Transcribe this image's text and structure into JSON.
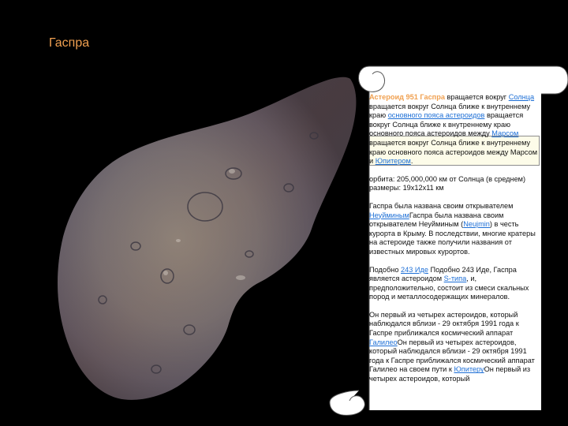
{
  "slide": {
    "title": "Гаспра"
  },
  "icons": {
    "scroll-top-curl": "scroll-curl-icon",
    "scroll-bottom-curl": "scroll-curl-icon"
  },
  "colors": {
    "title": "#f0a050",
    "link": "#1d6fd6",
    "background": "#000000",
    "scroll": "#ffffff"
  },
  "text": {
    "p1_lead": "Астероид 951 Гаспра",
    "p1_a": " вращается вокруг ",
    "p1_link_sun": "Солнца",
    "p1_b": " вращается вокруг Солнца ближе к внутреннему краю ",
    "p1_link_belt": "основного пояса астероидов",
    "p1_c": " вращается вокруг Солнца ближе к внутреннему краю основного пояса астероидов между ",
    "p1_link_mars": "Марсом",
    "p1_d": " вращается вокруг Солнца ближе к внутреннему краю основного пояса астероидов между Марсом и ",
    "p1_link_jupiter": "Юпитером",
    "p1_e": ".",
    "orbit": "орбита: 205,000,000 км от Солнца (в среднем)",
    "size": "размеры: 19x12x11 км",
    "p3_a": "Гаспра была названа своим открывателем ",
    "p3_link_neujmin": "Неуйминым",
    "p3_b": "Гаспра была названа своим открывателем Неуйминым (",
    "p3_link_neujmin_lat": "Neujmin",
    "p3_c": ") в честь курорта в Крыму. В последствии, многие кратеры на астероиде также получили названия от известных мировых курортов.",
    "p4_a": "  Подобно ",
    "p4_link_ida": "243 Иде",
    "p4_b": "  Подобно 243 Иде, Гаспра является астероидом ",
    "p4_link_stype": "S-типа",
    "p4_c": ", и, предположительно, состоит из смеси скальных пород и металлосодержащих минералов.",
    "p5_a": "Он первый из четырех астероидов, который наблюдался вблизи - 29 октября 1991 года к Гаспре приближался космический аппарат ",
    "p5_link_galileo": "Галилео",
    "p5_b": "Он первый из четырех астероидов, который наблюдался вблизи - 29 октября 1991 года к Гаспре приближался космический аппарат Галилео на своем пути к ",
    "p5_link_jupiter": "Юпитеру",
    "p5_c": "Он первый из четырех астероидов, который"
  }
}
